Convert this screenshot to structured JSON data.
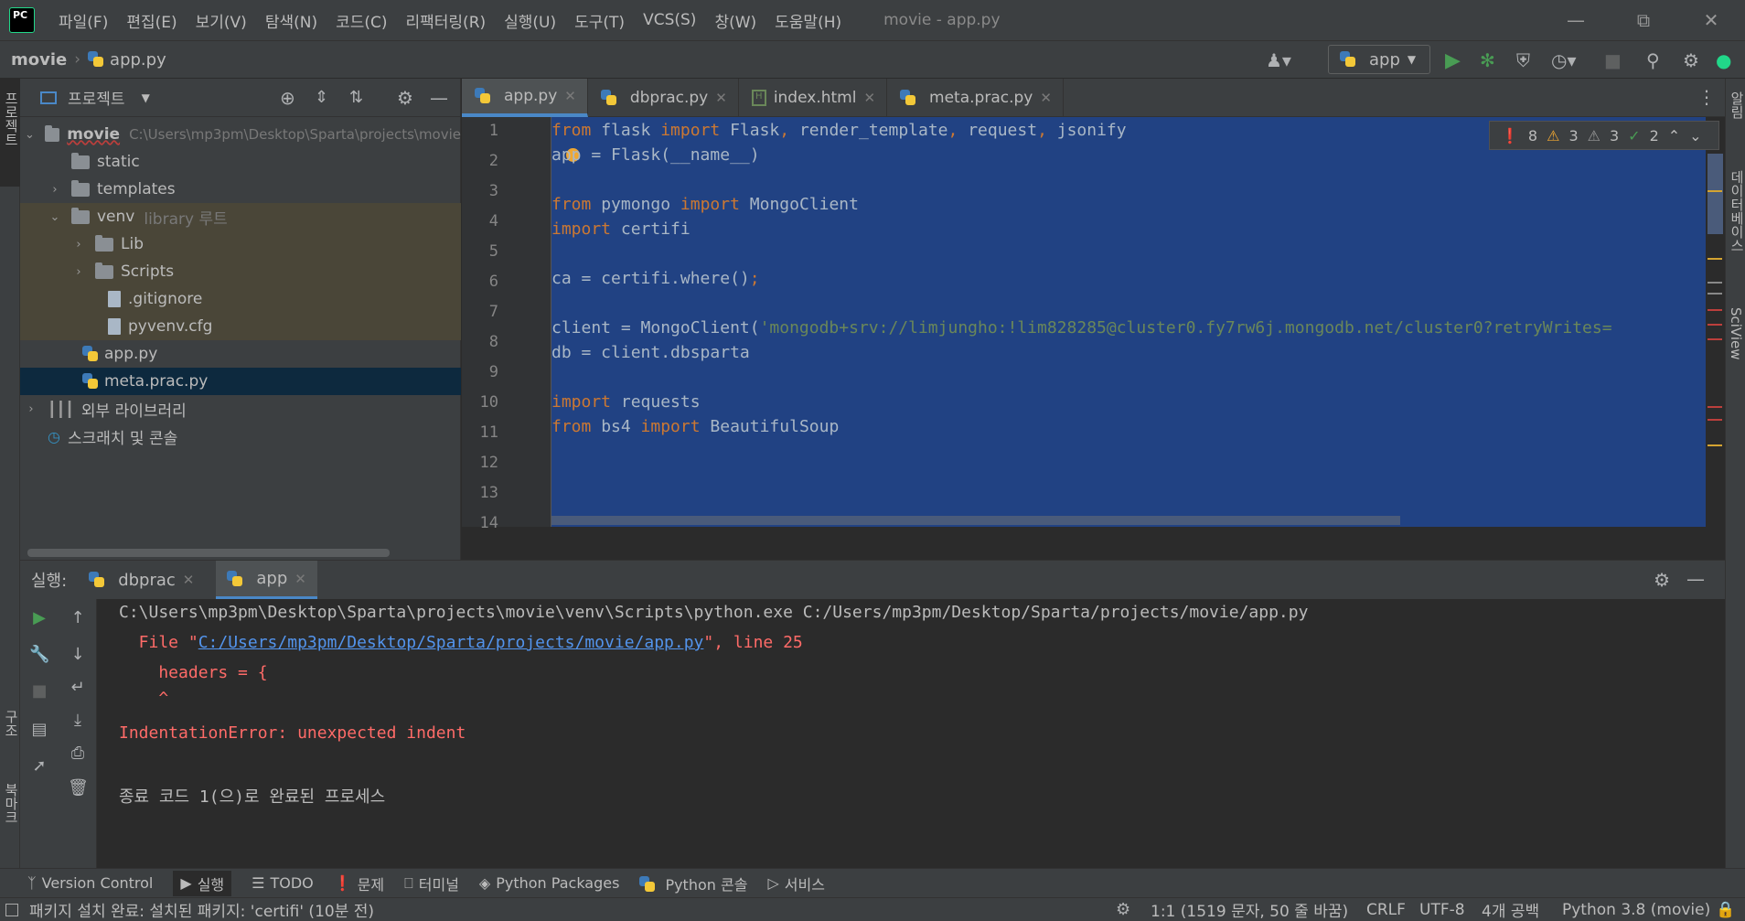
{
  "app": {
    "menu": [
      "파일(F)",
      "편집(E)",
      "보기(V)",
      "탐색(N)",
      "코드(C)",
      "리팩터링(R)",
      "실행(U)",
      "도구(T)",
      "VCS(S)",
      "창(W)",
      "도움말(H)"
    ],
    "window_title": "movie - app.py",
    "logo": "PC"
  },
  "navbar": {
    "project": "movie",
    "file": "app.py",
    "run_config": "app"
  },
  "project_panel": {
    "title": "프로젝트",
    "root_name": "movie",
    "root_path": "C:\\Users\\mp3pm\\Desktop\\Sparta\\projects\\movie",
    "items": [
      {
        "label": "static"
      },
      {
        "label": "templates"
      },
      {
        "label": "venv",
        "suffix": "library 루트"
      },
      {
        "label": "Lib"
      },
      {
        "label": "Scripts"
      },
      {
        "label": ".gitignore"
      },
      {
        "label": "pyvenv.cfg"
      },
      {
        "label": "app.py"
      },
      {
        "label": "meta.prac.py"
      },
      {
        "label": "외부 라이브러리"
      },
      {
        "label": "스크래치 및 콘솔"
      }
    ]
  },
  "editor": {
    "tabs": [
      {
        "label": "app.py",
        "active": true
      },
      {
        "label": "dbprac.py"
      },
      {
        "label": "index.html"
      },
      {
        "label": "meta.prac.py"
      }
    ],
    "inspections": {
      "errors": "8",
      "warnings": "3",
      "weak_warnings": "3",
      "typos": "2"
    },
    "line_numbers": [
      "1",
      "2",
      "3",
      "4",
      "5",
      "6",
      "7",
      "8",
      "9",
      "10",
      "11",
      "12",
      "13",
      "14"
    ],
    "lines": [
      "from flask import Flask, render_template, request, jsonify",
      "app = Flask(__name__)",
      "",
      "from pymongo import MongoClient",
      "import certifi",
      "",
      "ca = certifi.where();",
      "",
      "client = MongoClient('mongodb+srv://limjungho:!lim828285@cluster0.fy7rw6j.mongodb.net/cluster0?retryWrites=",
      "db = client.dbsparta",
      "",
      "import requests",
      "from bs4 import BeautifulSoup"
    ]
  },
  "run_panel": {
    "label": "실행:",
    "tabs": [
      {
        "label": "dbprac"
      },
      {
        "label": "app",
        "active": true
      }
    ],
    "output": {
      "cmd": "C:\\Users\\mp3pm\\Desktop\\Sparta\\projects\\movie\\venv\\Scripts\\python.exe C:/Users/mp3pm/Desktop/Sparta/projects/movie/app.py",
      "file_prefix": "  File \"",
      "file_link": "C:/Users/mp3pm/Desktop/Sparta/projects/movie/app.py",
      "file_suffix": "\", line 25",
      "code_line": "    headers = {",
      "caret": "    ^",
      "error": "IndentationError: unexpected indent",
      "exit": "종료 코드 1(으)로 완료된 프로세스"
    }
  },
  "tool_windows": [
    {
      "label": "Version Control"
    },
    {
      "label": "실행",
      "active": true
    },
    {
      "label": "TODO"
    },
    {
      "label": "문제"
    },
    {
      "label": "터미널"
    },
    {
      "label": "Python Packages"
    },
    {
      "label": "Python 콘솔"
    },
    {
      "label": "서비스"
    }
  ],
  "status_bar": {
    "message": "패키지 설치 완료: 설치된 패키지: 'certifi' (10분 전)",
    "position": "1:1 (1519 문자, 50 줄 바꿈)",
    "line_sep": "CRLF",
    "encoding": "UTF-8",
    "indent": "4개 공백",
    "interpreter": "Python 3.8 (movie)"
  },
  "side_labels": {
    "left_top": "프로젝트",
    "left_structure": "구조",
    "left_bookmarks": "북마크",
    "right_notifications": "알림",
    "right_database": "데이터베이스",
    "right_sciview": "SciView"
  }
}
